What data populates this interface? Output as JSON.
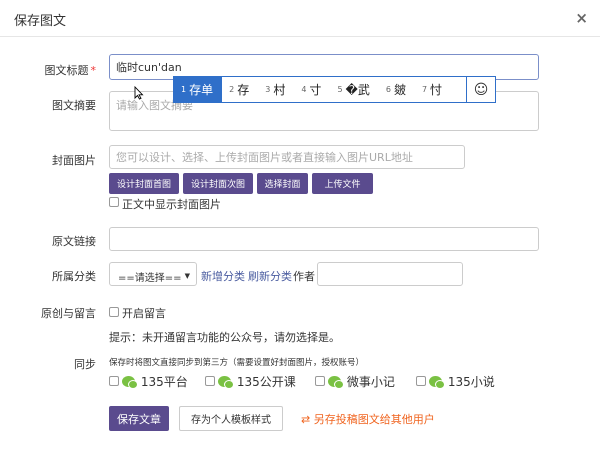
{
  "dialog": {
    "title": "保存图文",
    "close": "×"
  },
  "title_field": {
    "label": "图文标题",
    "required": "*",
    "value": "临时cun'dan"
  },
  "summary_field": {
    "label": "图文摘要",
    "placeholder": "请输入图文摘要"
  },
  "cover": {
    "label": "封面图片",
    "placeholder": "您可以设计、选择、上传封面图片或者直接输入图片URL地址",
    "buttons": [
      "设计封面首图",
      "设计封面次图",
      "选择封面",
      "上传文件"
    ],
    "show_in_body": "正文中显示封面图片"
  },
  "source_link": {
    "label": "原文链接"
  },
  "category": {
    "label": "所属分类",
    "selected": "==请选择==",
    "add": "新增分类",
    "refresh": "刷新分类",
    "author_label": "作者"
  },
  "comment": {
    "label": "原创与留言",
    "open": "开启留言",
    "tip": "提示：未开通留言功能的公众号，请勿选择是。"
  },
  "sync": {
    "label": "同步",
    "desc": "保存时将图文直接同步到第三方（需要设置好封面图片，授权账号）",
    "targets": [
      "135平台",
      "135公开课",
      "微事小记",
      "135小说"
    ]
  },
  "actions": {
    "save": "保存文章",
    "template": "存为个人模板样式",
    "share": "⇄ 另存投稿图文给其他用户"
  },
  "ime": {
    "candidates": [
      {
        "num": "1",
        "text": "存单"
      },
      {
        "num": "2",
        "text": "存"
      },
      {
        "num": "3",
        "text": "村"
      },
      {
        "num": "4",
        "text": "寸"
      },
      {
        "num": "5",
        "text": "�武"
      },
      {
        "num": "6",
        "text": "皴"
      },
      {
        "num": "7",
        "text": "忖"
      }
    ],
    "emoji": "☺"
  }
}
